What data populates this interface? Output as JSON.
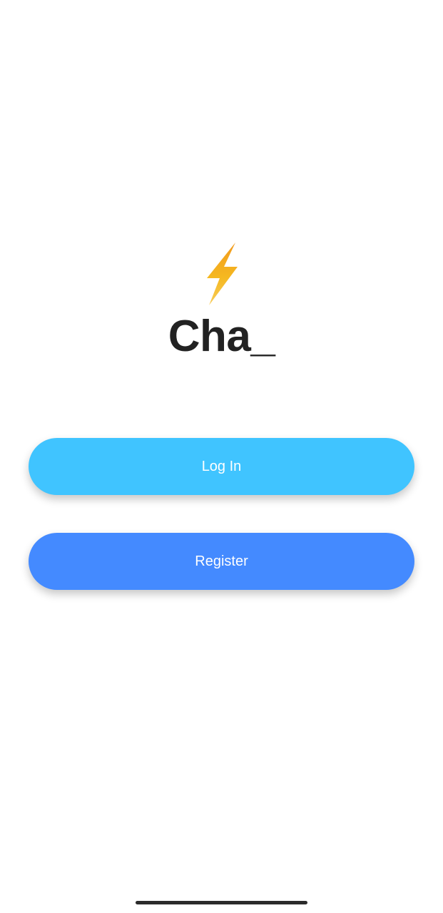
{
  "app": {
    "title": "Cha_",
    "logo_icon": "lightning-bolt-icon"
  },
  "buttons": {
    "login_label": "Log In",
    "register_label": "Register"
  },
  "colors": {
    "login_button": "#40C4FF",
    "register_button": "#448AFF",
    "title_text": "#222222",
    "bolt_gold": "#F5B820",
    "bolt_orange": "#F29A1E"
  }
}
